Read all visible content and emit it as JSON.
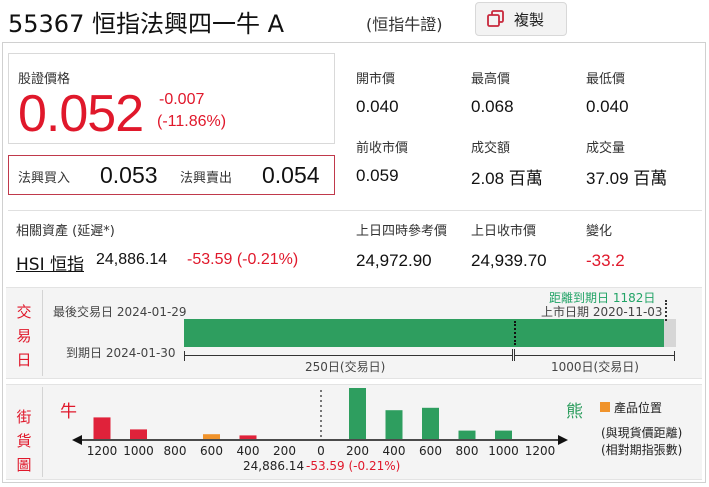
{
  "header": {
    "code_name": "55367 恒指法興四一牛 A",
    "sub_name": "(恒指牛證)",
    "copy_label": "複製"
  },
  "quote": {
    "price_label": "股證價格",
    "price": "0.052",
    "change": "-0.007",
    "change_pct": "(-11.86%)",
    "bid_label": "法興買入",
    "bid": "0.053",
    "ask_label": "法興賣出",
    "ask": "0.054"
  },
  "stats": {
    "open_label": "開市價",
    "open": "0.040",
    "high_label": "最高價",
    "high": "0.068",
    "low_label": "最低價",
    "low": "0.040",
    "prev_label": "前收市價",
    "prev": "0.059",
    "turnover_label": "成交額",
    "turnover": "2.08 百萬",
    "volume_label": "成交量",
    "volume": "37.09 百萬"
  },
  "underlying": {
    "label": "相關資產 (延遲*)",
    "name": "HSI 恒指",
    "price": "24,886.14",
    "change": "-53.59 (-0.21%)",
    "ref_label": "上日四時參考價",
    "ref": "24,972.90",
    "close_label": "上日收市價",
    "close": "24,939.70",
    "diff_label": "變化",
    "diff": "-33.2"
  },
  "trade_day": {
    "vertical": [
      "交",
      "易",
      "日"
    ],
    "last_trade": "最後交易日 2024-01-29",
    "expiry": "到期日 2024-01-30",
    "days_left": "距離到期日 1182日",
    "listing": "上市日期 2020-11-03",
    "label_250": "250日(交易日)",
    "label_1000": "1000日(交易日)",
    "elapsed_fraction": 0.975
  },
  "street": {
    "vertical": [
      "街",
      "貨",
      "圖"
    ],
    "bull": "牛",
    "bear": "熊",
    "legend": "產品位置",
    "note1": "(與現貨價距離)",
    "note2": "(相對期指張數)",
    "ticks": [
      "1200",
      "1000",
      "800",
      "600",
      "400",
      "200",
      "0",
      "200",
      "400",
      "600",
      "800",
      "1000",
      "1200"
    ],
    "underlying_price": "24,886.14",
    "underlying_change": "-53.59 (-0.21%)",
    "colors": {
      "bull": "#e0223a",
      "bear": "#2e9e5f",
      "product": "#f0932b"
    }
  },
  "chart_data": {
    "type": "bar",
    "categories": [
      "1200",
      "1000",
      "800",
      "600",
      "400",
      "200",
      "0",
      "200",
      "400",
      "600",
      "800",
      "1000",
      "1200"
    ],
    "series": [
      {
        "name": "牛",
        "values": [
          18,
          8,
          0,
          4,
          3,
          0,
          0,
          0,
          0,
          0,
          0,
          0,
          0
        ]
      },
      {
        "name": "熊",
        "values": [
          0,
          0,
          0,
          0,
          0,
          0,
          0,
          44,
          24,
          26,
          7,
          7,
          0
        ]
      }
    ],
    "product_bucket": "600"
  }
}
